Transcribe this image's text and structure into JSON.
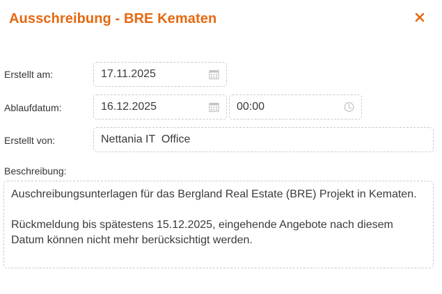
{
  "dialog": {
    "title": "Ausschreibung - BRE Kematen"
  },
  "form": {
    "created_at_label": "Erstellt am:",
    "created_at_value": "17.11.2025",
    "expiry_label": "Ablaufdatum:",
    "expiry_date_value": "16.12.2025",
    "expiry_time_value": "00:00",
    "created_by_label": "Erstellt von:",
    "created_by_value": "Nettania IT  Office",
    "description_label": "Beschreibung:",
    "description_paragraph_1": "Auschreibungsunterlagen für das Bergland Real Estate (BRE) Projekt in Kematen.",
    "description_paragraph_2": "Rückmeldung bis spätestens 15.12.2025, eingehende Angebote nach diesem Datum können nicht mehr berücksichtigt werden."
  },
  "icons": {
    "close": "close-icon",
    "calendar": "calendar-icon",
    "clock": "clock-icon"
  },
  "colors": {
    "accent": "#e5680f",
    "field_border": "#c9c9c9",
    "icon_gray": "#c4c4c4"
  }
}
